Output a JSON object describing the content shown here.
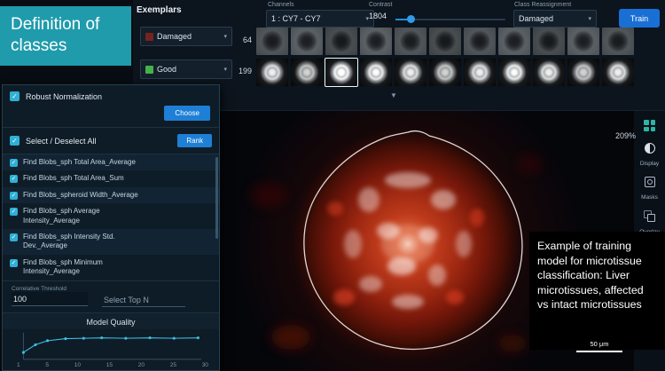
{
  "colors": {
    "teal-card": "#1f9bac",
    "accent-blue": "#1e7fd6",
    "train-blue": "#1a6fd4",
    "checkbox-cyan": "#2fb0d5",
    "chart-line": "#3ec1e0",
    "class-damaged": "#76231f",
    "class-good": "#45b14b"
  },
  "title_card": {
    "text": "Definition of classes"
  },
  "exemplars": {
    "title": "Exemplars",
    "class_selectors": [
      {
        "label": "Damaged",
        "color": "#76231f"
      },
      {
        "label": "Good",
        "color": "#45b14b"
      }
    ],
    "channels": {
      "label": "Channels",
      "value": "1 : CY7 - CY7"
    },
    "contrast": {
      "label": "Contrast",
      "value": "1804"
    },
    "class_reassignment": {
      "label": "Class Reassignment",
      "value": "Damaged"
    },
    "train_button": "Train",
    "rows": [
      {
        "count": "64"
      },
      {
        "count": "199"
      }
    ]
  },
  "feature_panel": {
    "robust_normalization": {
      "label": "Robust Normalization",
      "button": "Choose"
    },
    "select_all": {
      "label": "Select / Deselect All",
      "button": "Rank"
    },
    "features": [
      "Find Blobs_sph Total Area_Average",
      "Find Blobs_sph Total Area_Sum",
      "Find Blobs_spheroid Width_Average",
      "Find Blobs_sph Average Intensity_Average",
      "Find Blobs_sph Intensity Std. Dev._Average",
      "Find Blobs_sph Minimum Intensity_Average"
    ],
    "correlative_threshold": {
      "label": "Correlative Threshold",
      "value": "100"
    },
    "select_top_n": {
      "label": "Select Top N"
    },
    "model_quality": {
      "title": "Model Quality",
      "chart_data": {
        "type": "line",
        "x": [
          1,
          3,
          5,
          8,
          11,
          14,
          18,
          22,
          26,
          30
        ],
        "y": [
          0.55,
          0.74,
          0.84,
          0.89,
          0.9,
          0.91,
          0.9,
          0.91,
          0.9,
          0.91
        ],
        "xlim": [
          1,
          30
        ],
        "ylim": [
          0.4,
          1.0
        ],
        "x_ticks": [
          "1",
          "5",
          "10",
          "15",
          "20",
          "25",
          "30"
        ]
      }
    }
  },
  "viewer": {
    "zoom": "209%",
    "scale_bar": "50 μm"
  },
  "right_toolbar": {
    "groups": [
      {
        "icon": "contrast-icon",
        "label": "Display"
      },
      {
        "icon": "mask-icon",
        "label": "Masks"
      },
      {
        "icon": "overlay-icon",
        "label": "Overlay"
      }
    ]
  },
  "caption": {
    "text": "Example of training model for microtissue classification: Liver microtissues, affected vs intact microtissues"
  }
}
